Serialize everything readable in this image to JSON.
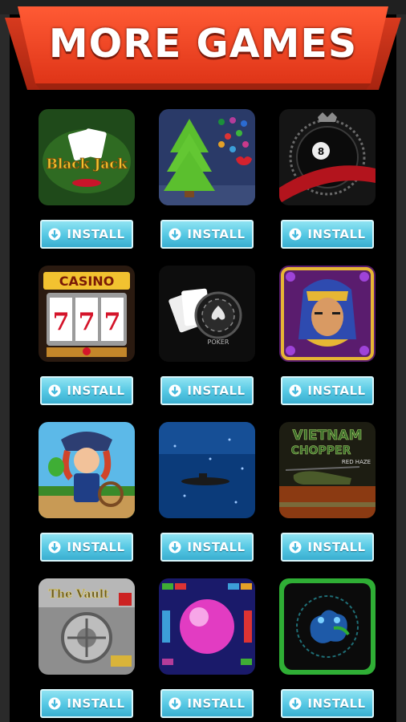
{
  "header": {
    "title": "MORE GAMES"
  },
  "install_label": "INSTALL",
  "tile_text": {
    "blackjack": "Black Jack",
    "casino": "CASINO",
    "poker": "POKER",
    "vietnam_title": "VIETNAM",
    "vietnam_sub": "CHOPPER",
    "vietnam_tag": "RED HAZE",
    "vault": "The Vault"
  },
  "games": [
    {
      "id": "blackjack",
      "icon": "blackjack-icon"
    },
    {
      "id": "christmas-tree",
      "icon": "christmas-tree-icon"
    },
    {
      "id": "eight-ball",
      "icon": "eight-ball-icon"
    },
    {
      "id": "casino-slots",
      "icon": "slot-machine-icon"
    },
    {
      "id": "poker",
      "icon": "poker-chip-icon"
    },
    {
      "id": "pharaoh",
      "icon": "pharaoh-icon"
    },
    {
      "id": "pirate",
      "icon": "pirate-icon"
    },
    {
      "id": "submarine",
      "icon": "submarine-icon"
    },
    {
      "id": "vietnam-chopper",
      "icon": "helicopter-icon"
    },
    {
      "id": "vault",
      "icon": "vault-icon"
    },
    {
      "id": "bubble-breaker",
      "icon": "ball-bricks-icon"
    },
    {
      "id": "green-frog",
      "icon": "frog-icon"
    }
  ],
  "colors": {
    "banner_top": "#f24a2c",
    "banner_bottom": "#e13a1c",
    "button": "#54c7e3",
    "background": "#000000"
  }
}
